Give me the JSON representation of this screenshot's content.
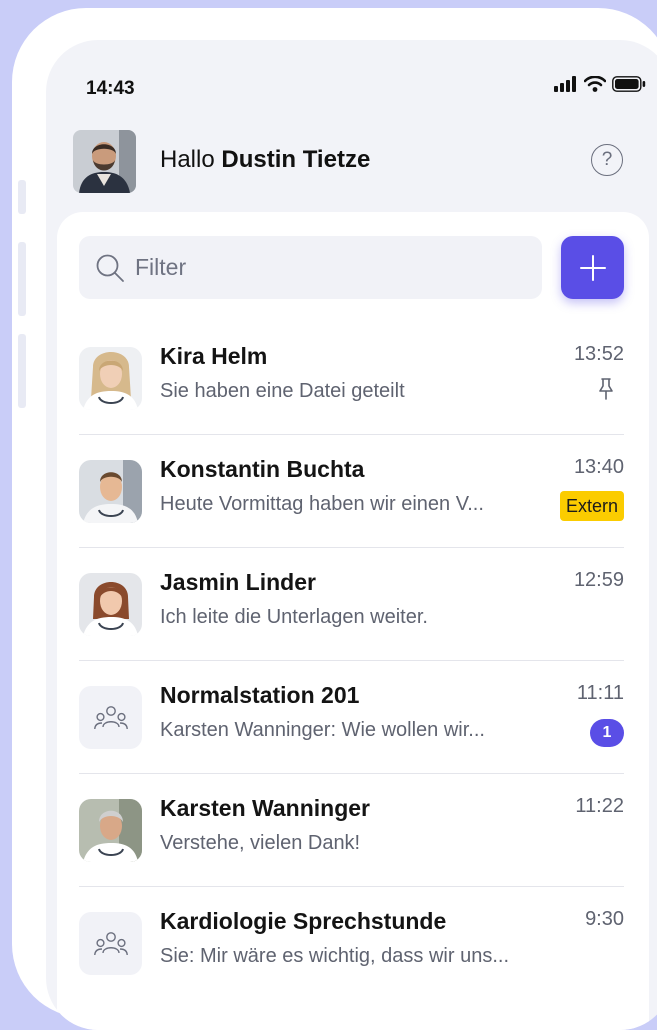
{
  "status_bar": {
    "time": "14:43"
  },
  "header": {
    "greeting_prefix": "Hallo",
    "user_name": "Dustin Tietze",
    "help_label": "?"
  },
  "search": {
    "placeholder": "Filter"
  },
  "add_button": {
    "icon": "plus-icon"
  },
  "colors": {
    "accent": "#5a4ee6",
    "extern_badge": "#fbcc00",
    "background": "#c9cdf8"
  },
  "chats": [
    {
      "name": "Kira Helm",
      "preview": "Sie haben eine Datei geteilt",
      "time": "13:52",
      "pinned": true
    },
    {
      "name": "Konstantin Buchta",
      "preview": "Heute Vormittag haben wir einen V...",
      "time": "13:40",
      "tag": "Extern"
    },
    {
      "name": "Jasmin Linder",
      "preview": "Ich leite die Unterlagen weiter.",
      "time": "12:59"
    },
    {
      "name": "Normalstation 201",
      "preview": "Karsten Wanninger: Wie wollen wir...",
      "time": "11:11",
      "unread": "1",
      "group": true
    },
    {
      "name": "Karsten Wanninger",
      "preview": "Verstehe, vielen Dank!",
      "time": "11:22"
    },
    {
      "name": "Kardiologie Sprechstunde",
      "preview": "Sie: Mir wäre es wichtig, dass wir uns...",
      "time": "9:30",
      "group": true
    }
  ]
}
